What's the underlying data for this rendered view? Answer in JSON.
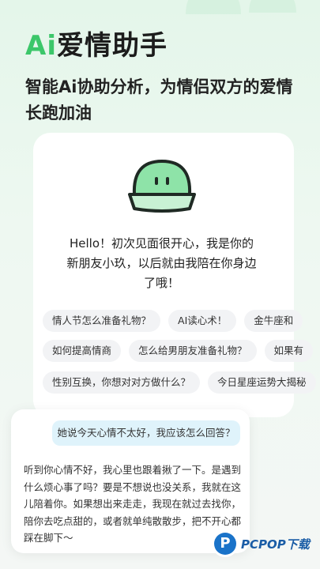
{
  "header": {
    "title_accent": "Ai",
    "title_rest": "爱情助手",
    "subtitle": "智能Ai协助分析，为情侣双方的爱情长跑加油"
  },
  "greeting": {
    "text": "Hello！初次见面很开心，我是你的新朋友小玖，以后就由我陪在你身边了哦！"
  },
  "suggestions": {
    "row1": [
      "情人节怎么准备礼物？",
      "AI读心术！",
      "金牛座和"
    ],
    "row2": [
      "如何提高情商",
      "怎么给男朋友准备礼物？",
      "如果有"
    ],
    "row3": [
      "性别互换，你想对对方做什么？",
      "今日星座运势大揭秘"
    ]
  },
  "chat": {
    "user_message": "她说今天心情不太好，我应该怎么回答？",
    "ai_reply": "听到你心情不好，我心里也跟着揪了一下。是遇到什么烦心事了吗？要是不想说也没关系，我就在这儿陪着你。如果想出来走走，我现在就过去找你，陪你去吃点甜的，或者就单纯散散步，把不开心都踩在脚下～"
  },
  "watermark": {
    "logo_letter": "P",
    "text": "PCPOP下载"
  },
  "colors": {
    "accent": "#3cc76a",
    "bubble": "#dff3fb",
    "chip": "#f2f3f5"
  }
}
